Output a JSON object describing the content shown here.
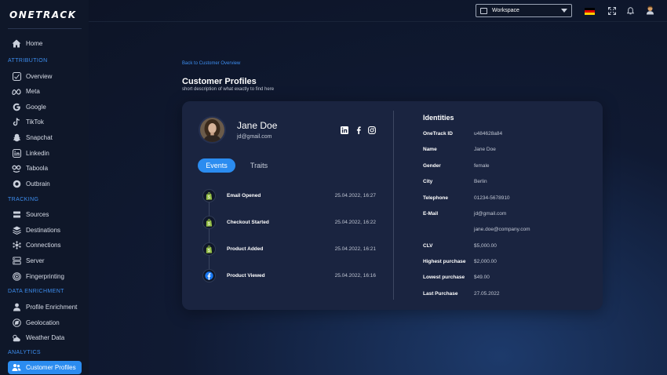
{
  "app": {
    "logo": "ONETRACK"
  },
  "sidebar": {
    "home": "Home",
    "sections": {
      "attribution": "ATTRIBUTION",
      "tracking": "TRACKING",
      "data_enrichment": "DATA ENRICHMENT",
      "analytics": "ANALYTICS"
    },
    "attribution_items": [
      "Overview",
      "Meta",
      "Google",
      "TikTok",
      "Snapchat",
      "Linkedin",
      "Taboola",
      "Outbrain"
    ],
    "tracking_items": [
      "Sources",
      "Destinations",
      "Connections",
      "Server",
      "Fingerprinting"
    ],
    "enrichment_items": [
      "Profile Enrichment",
      "Geolocation",
      "Weather Data"
    ],
    "analytics_items": [
      "Customer Profiles"
    ]
  },
  "topbar": {
    "workspace": "Workspace"
  },
  "page": {
    "back_link": "Back to Customer Overview",
    "title": "Customer Profiles",
    "subtitle": "short description of what exactly to find here"
  },
  "profile": {
    "name": "Jane Doe",
    "email": "jd@gmail.com",
    "tabs": {
      "events": "Events",
      "traits": "Traits"
    }
  },
  "events": [
    {
      "name": "Email Opened",
      "date": "25.04.2022, 16:27",
      "icon": "shopify-icon"
    },
    {
      "name": "Checkout Started",
      "date": "25.04.2022, 16:22",
      "icon": "shopify-icon"
    },
    {
      "name": "Product Added",
      "date": "25.04.2022, 16:21",
      "icon": "shopify-icon"
    },
    {
      "name": "Product Viewed",
      "date": "25.04.2022, 16:16",
      "icon": "facebook-icon"
    }
  ],
  "identities": {
    "title": "Identities",
    "rows": [
      {
        "label": "OneTrack ID",
        "value": "u484628a84"
      },
      {
        "label": "Name",
        "value": "Jane Doe"
      },
      {
        "label": "Gender",
        "value": "female"
      },
      {
        "label": "City",
        "value": "Berlin"
      },
      {
        "label": "Telephone",
        "value": "01234-5678910"
      },
      {
        "label": "E-Mail",
        "value": "jd@gmail.com"
      },
      {
        "label": "",
        "value": "jane.doe@company.com"
      },
      {
        "label": "CLV",
        "value": "$5,000.00"
      },
      {
        "label": "Highest purchase",
        "value": "$2,000.00"
      },
      {
        "label": "Lowest purchase",
        "value": "$49.00"
      },
      {
        "label": "Last Purchase",
        "value": "27.05.2022"
      }
    ]
  },
  "colors": {
    "accent": "#2b8cf0",
    "section_label": "#3d8ef0",
    "card": "#1a2440",
    "sidebar": "#0f1729"
  }
}
